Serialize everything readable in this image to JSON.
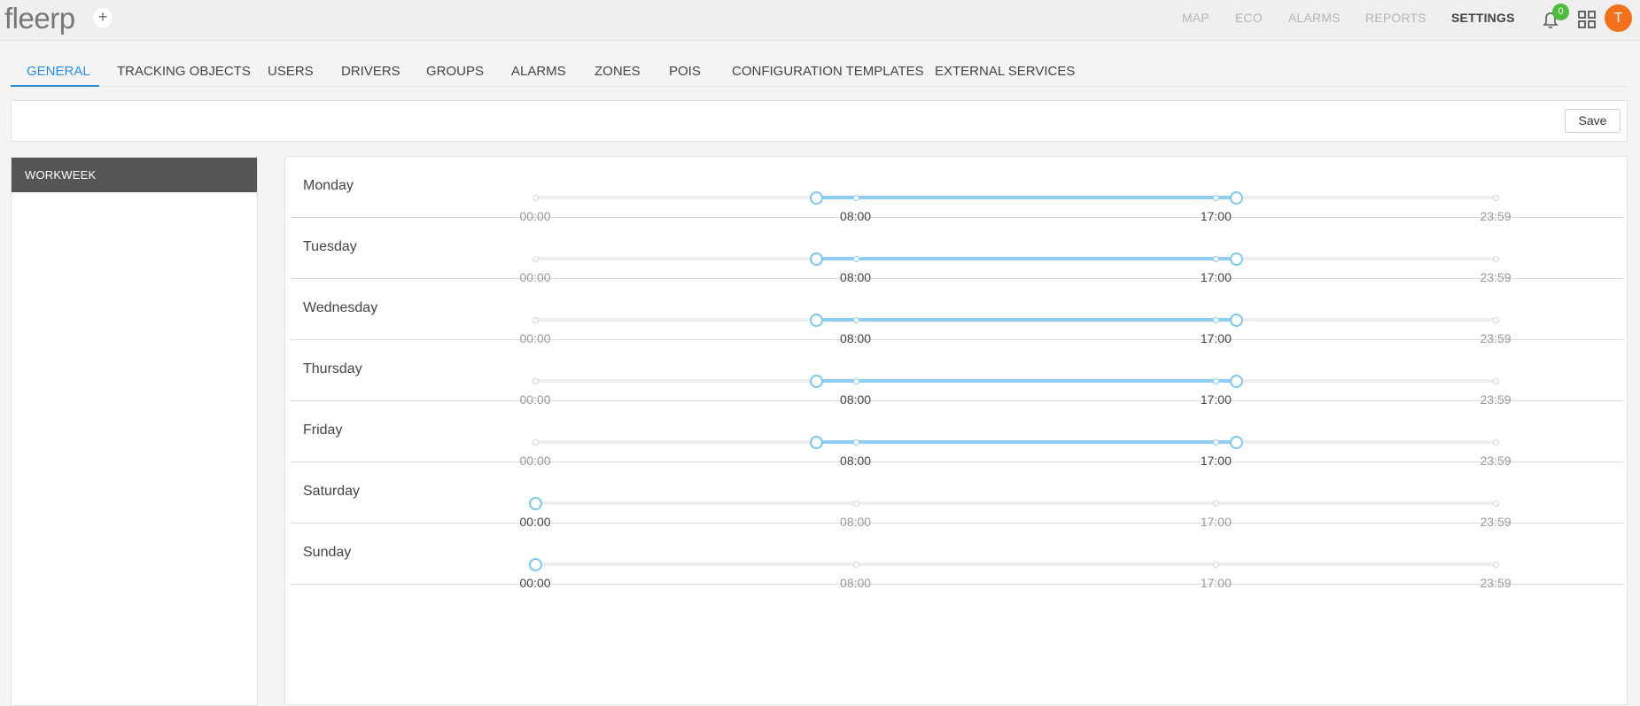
{
  "app": {
    "logo": "fleerp",
    "plus": "+"
  },
  "nav": [
    {
      "label": "MAP",
      "active": false
    },
    {
      "label": "ECO",
      "active": false
    },
    {
      "label": "ALARMS",
      "active": false
    },
    {
      "label": "REPORTS",
      "active": false
    },
    {
      "label": "SETTINGS",
      "active": true
    }
  ],
  "notifications": {
    "count": "0"
  },
  "user": {
    "initial": "T"
  },
  "tabs": [
    {
      "label": "GENERAL",
      "active": true
    },
    {
      "label": "TRACKING OBJECTS"
    },
    {
      "label": "USERS"
    },
    {
      "label": "DRIVERS"
    },
    {
      "label": "GROUPS"
    },
    {
      "label": "ALARMS"
    },
    {
      "label": "ZONES"
    },
    {
      "label": "POIS"
    },
    {
      "label": "CONFIGURATION TEMPLATES"
    },
    {
      "label": "EXTERNAL SERVICES"
    }
  ],
  "toolbar": {
    "save_label": "Save"
  },
  "sidebar": {
    "items": [
      {
        "label": "WORKWEEK",
        "active": true
      }
    ]
  },
  "schedule": {
    "tick_labels": [
      "00:00",
      "08:00",
      "17:00",
      "23:59"
    ],
    "days": [
      {
        "name": "Monday",
        "working": true,
        "start": "08:00",
        "end": "17:00"
      },
      {
        "name": "Tuesday",
        "working": true,
        "start": "08:00",
        "end": "17:00"
      },
      {
        "name": "Wednesday",
        "working": true,
        "start": "08:00",
        "end": "17:00"
      },
      {
        "name": "Thursday",
        "working": true,
        "start": "08:00",
        "end": "17:00"
      },
      {
        "name": "Friday",
        "working": true,
        "start": "08:00",
        "end": "17:00"
      },
      {
        "name": "Saturday",
        "working": false
      },
      {
        "name": "Sunday",
        "working": false
      }
    ]
  },
  "colors": {
    "accent": "#2d8ed8",
    "range": "#8ecef2",
    "badge": "#4cbc3c",
    "avatar": "#f2711c",
    "sidebar_active": "#555555"
  }
}
